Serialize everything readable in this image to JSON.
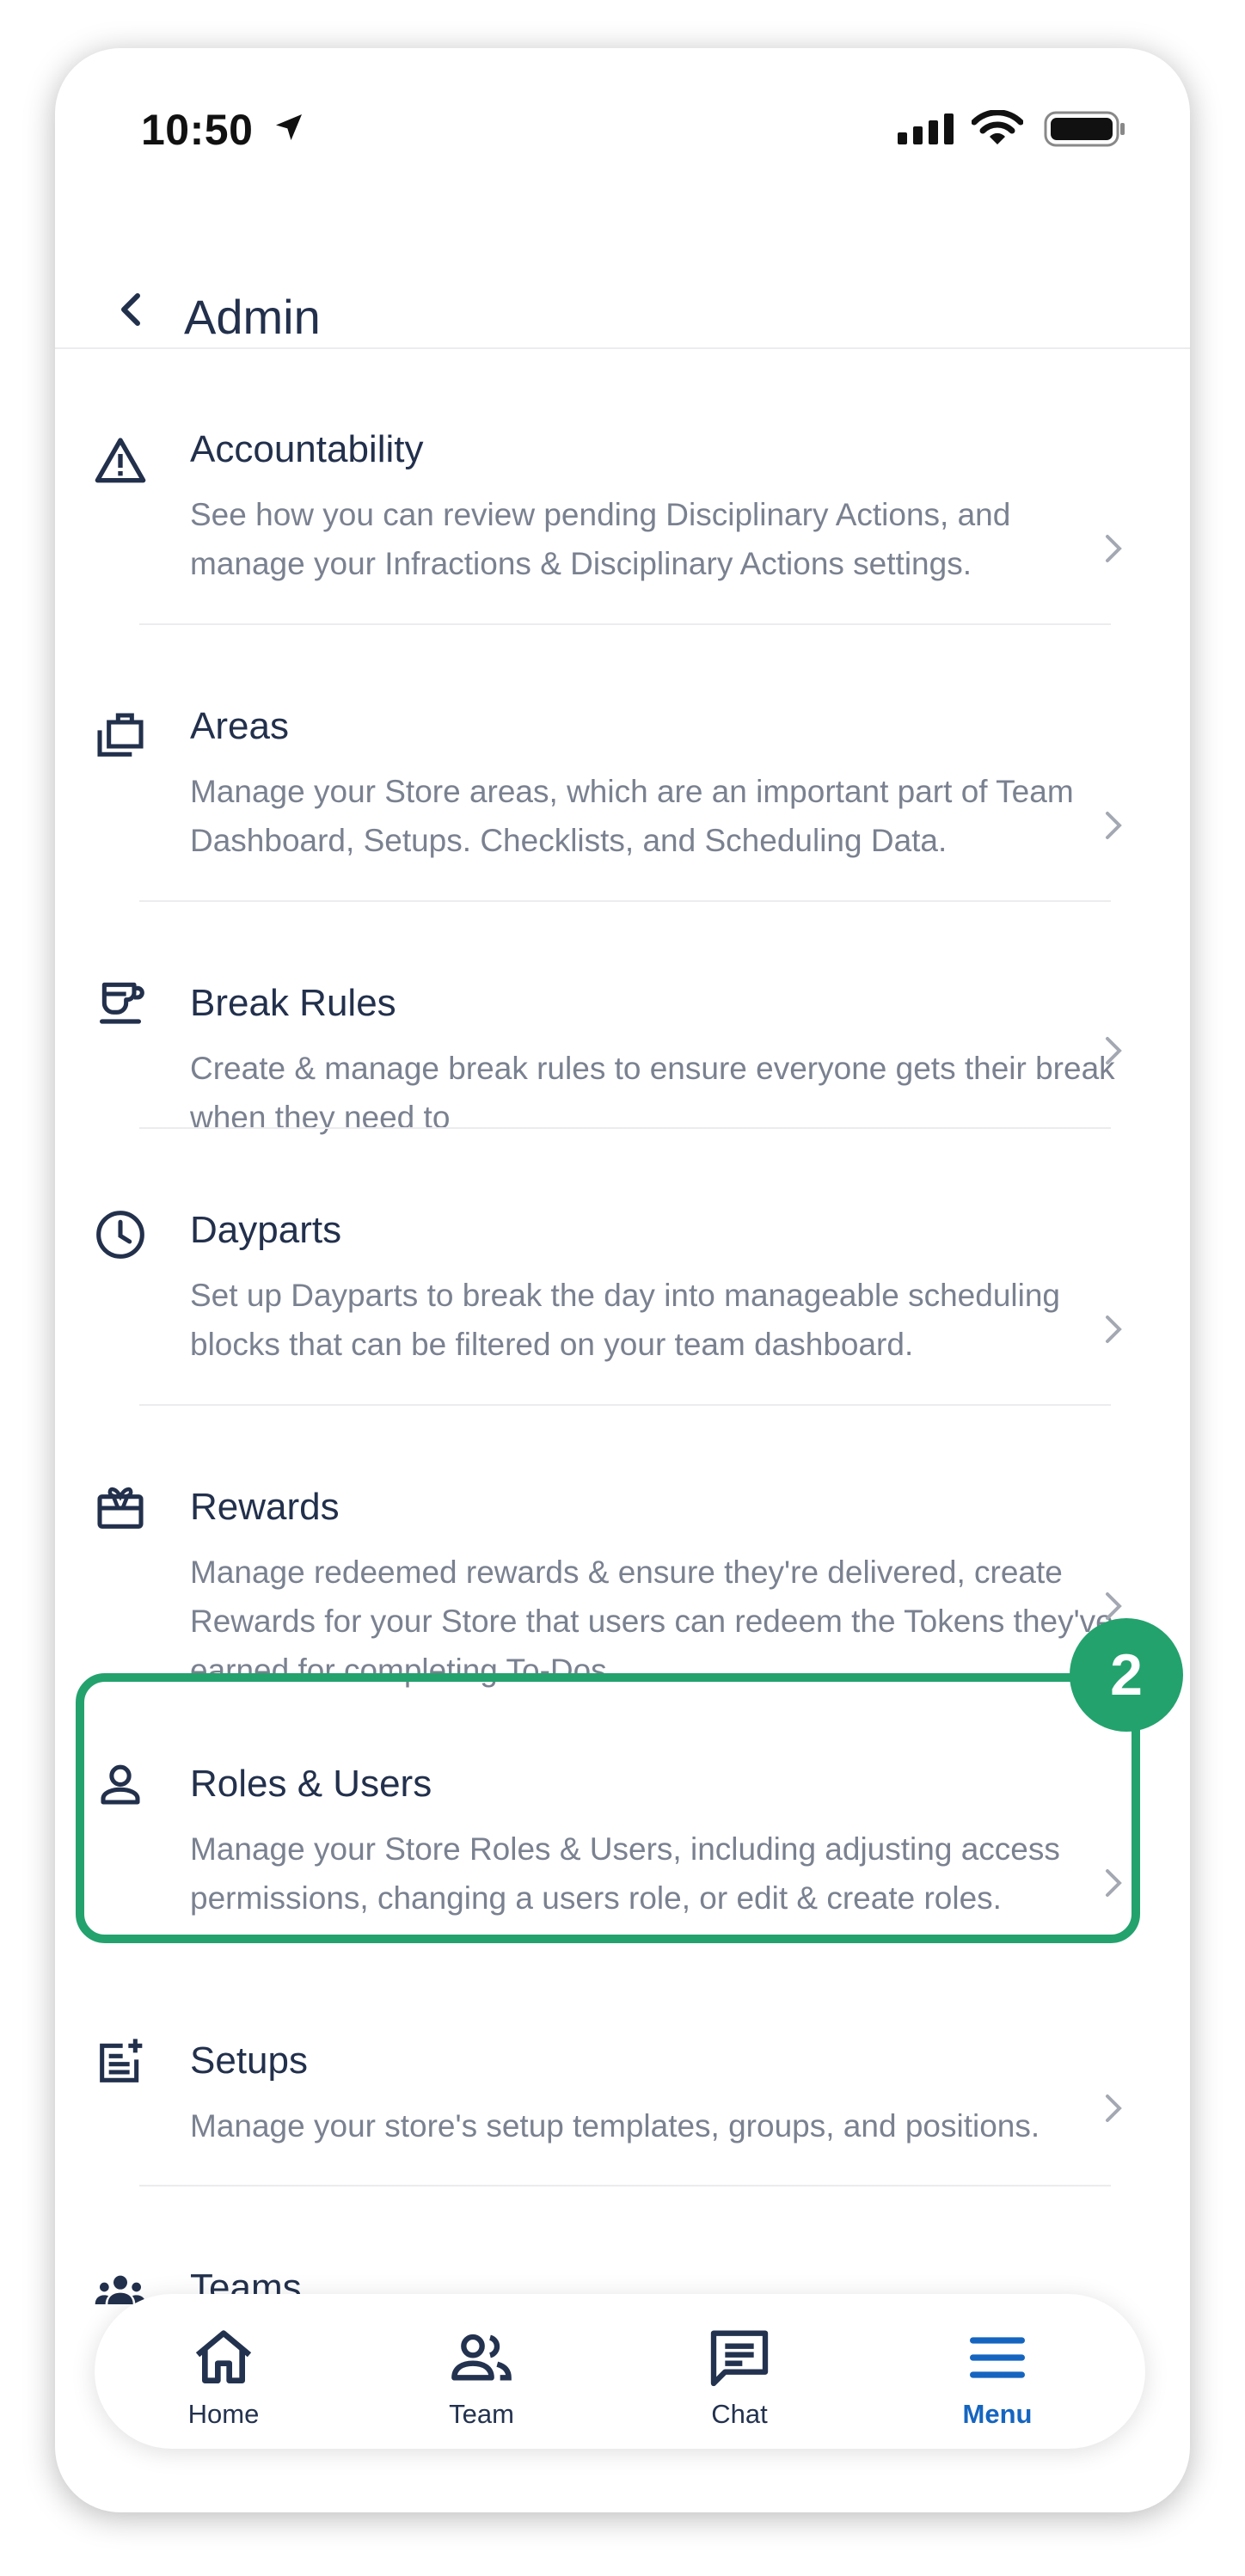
{
  "status_bar": {
    "time": "10:50"
  },
  "header": {
    "title": "Admin"
  },
  "items": [
    {
      "title": "Accountability",
      "desc": "See how you can review pending Disciplinary Actions, and manage your Infractions & Disciplinary Actions settings.",
      "icon": "warning-triangle-icon"
    },
    {
      "title": "Areas",
      "desc": "Manage your Store areas, which are an important part of Team Dashboard, Setups. Checklists, and Scheduling Data.",
      "icon": "briefcase-icon"
    },
    {
      "title": "Break Rules",
      "desc": "Create & manage break rules to ensure everyone gets their break when they need to",
      "icon": "coffee-cup-icon"
    },
    {
      "title": "Dayparts",
      "desc": "Set up Dayparts to break the day into manageable scheduling blocks that can be filtered on your team dashboard.",
      "icon": "clock-icon"
    },
    {
      "title": "Rewards",
      "desc": "Manage redeemed rewards & ensure they're delivered, create Rewards for your Store that users can redeem the Tokens they've earned for completing To-Dos.",
      "icon": "gift-card-icon"
    },
    {
      "title": "Roles & Users",
      "desc": "Manage your Store Roles & Users, including adjusting access permissions, changing a users role, or edit & create roles.",
      "icon": "person-icon"
    },
    {
      "title": "Setups",
      "desc": "Manage your store's setup templates, groups, and positions.",
      "icon": "post-add-icon"
    },
    {
      "title": "Teams",
      "desc": "",
      "icon": "group-icon"
    }
  ],
  "annotation": {
    "step": "2"
  },
  "tabs": [
    {
      "label": "Home",
      "icon": "home-icon"
    },
    {
      "label": "Team",
      "icon": "people-icon"
    },
    {
      "label": "Chat",
      "icon": "chat-icon"
    },
    {
      "label": "Menu",
      "icon": "menu-icon",
      "active": true
    }
  ],
  "colors": {
    "accent": "#1565c0",
    "highlight": "#23a26d",
    "text": "#22304c",
    "secondary_text": "#7a8190"
  }
}
